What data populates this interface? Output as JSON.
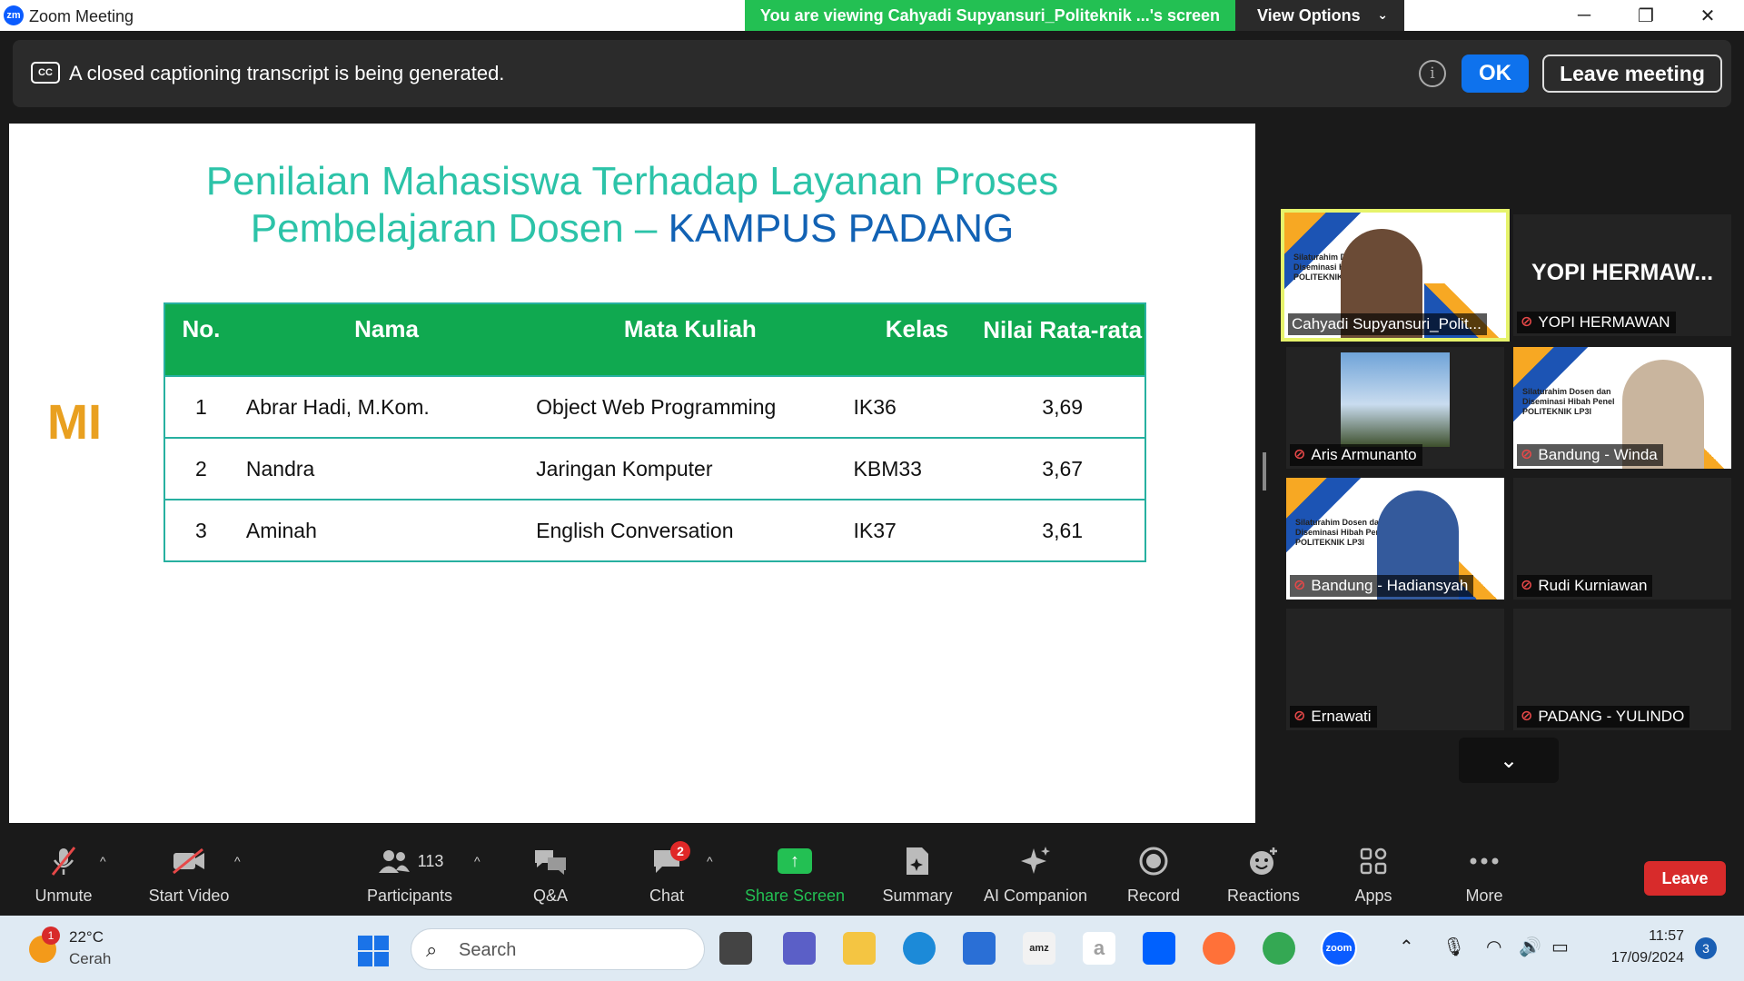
{
  "window": {
    "app_logo": "zm",
    "title": "Zoom Meeting",
    "viewing_banner": "You are viewing Cahyadi Supyansuri_Politeknik ...'s screen",
    "view_options": "View Options"
  },
  "caption_banner": {
    "icon": "CC",
    "text": "A closed captioning transcript is being generated.",
    "ok_label": "OK",
    "leave_label": "Leave meeting"
  },
  "slide": {
    "title_line1": "Penilaian Mahasiswa Terhadap Layanan Proses",
    "title_line2_prefix": "Pembelajaran Dosen – ",
    "title_line2_campus": "KAMPUS PADANG",
    "logo_text": "MI",
    "table": {
      "headers": [
        "No.",
        "Nama",
        "Mata Kuliah",
        "Kelas",
        "Nilai Rata-rata"
      ],
      "rows": [
        [
          "1",
          "Abrar Hadi, M.Kom.",
          "Object Web Programming",
          "IK36",
          "3,69"
        ],
        [
          "2",
          "Nandra",
          "Jaringan Komputer",
          "KBM33",
          "3,67"
        ],
        [
          "3",
          "Aminah",
          "English Conversation",
          "IK37",
          "3,61"
        ]
      ]
    }
  },
  "gallery": {
    "tiles": [
      {
        "name": "Cahyadi Supyansuri_Polit...",
        "active": true
      },
      {
        "name": "YOPI HERMAWAN",
        "big_name": "YOPI HERMAW...",
        "muted": true
      },
      {
        "name": "Aris Armunanto",
        "muted": true
      },
      {
        "name": "Bandung - Winda",
        "muted": true
      },
      {
        "name": "Bandung - Hadiansyah",
        "muted": true
      },
      {
        "name": "Rudi Kurniawan",
        "muted": true
      },
      {
        "name": "Ernawati",
        "muted": true
      },
      {
        "name": "PADANG - YULINDO",
        "muted": true
      }
    ],
    "tile_slide_text": "Silaturahim Dosen dan Diseminasi Hibah Penel POLITEKNIK LP3I"
  },
  "toolbar": {
    "unmute": "Unmute",
    "start_video": "Start Video",
    "participants": "Participants",
    "participants_count": "113",
    "qa": "Q&A",
    "chat": "Chat",
    "chat_badge": "2",
    "share_screen": "Share Screen",
    "summary": "Summary",
    "ai_companion": "AI Companion",
    "record": "Record",
    "reactions": "Reactions",
    "apps": "Apps",
    "more": "More",
    "leave": "Leave"
  },
  "taskbar": {
    "weather_badge": "1",
    "temperature": "22°C",
    "condition": "Cerah",
    "search_placeholder": "Search",
    "time": "11:57",
    "date": "17/09/2024",
    "notification_count": "3"
  },
  "colors": {
    "zoom_blue": "#0e72ed",
    "share_green": "#23c053",
    "leave_red": "#d82b2b",
    "table_header_green": "#10a950",
    "slide_title_teal": "#2cc3a8",
    "slide_title_blue": "#1262b4"
  }
}
